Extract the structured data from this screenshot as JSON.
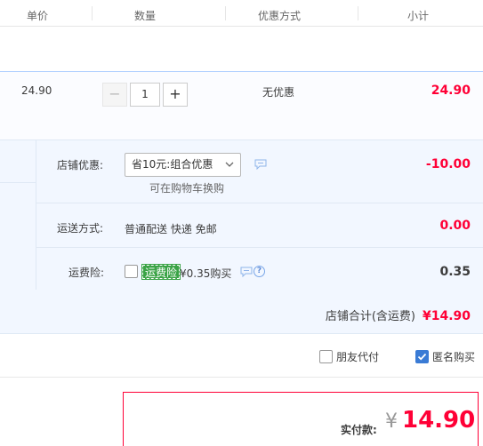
{
  "header": {
    "col_unit_price": "单价",
    "col_quantity": "数量",
    "col_promotion": "优惠方式",
    "col_subtotal": "小计"
  },
  "item": {
    "unit_price": "24.90",
    "quantity": "1",
    "minus_label": "−",
    "plus_label": "+",
    "promotion": "无优惠",
    "subtotal": "24.90"
  },
  "shop": {
    "discount_label": "店铺优惠:",
    "discount_selected": "省10元:组合优惠",
    "discount_hint": "可在购物车换购",
    "discount_amount": "-10.00",
    "shipping_label": "运送方式:",
    "shipping_method": "普通配送 快递 免邮",
    "shipping_amount": "0.00",
    "insurance_label": "运费险:",
    "insurance_tag": "运费险",
    "insurance_price": "¥0.35购买",
    "insurance_amount": "0.35",
    "total_label": "店铺合计(含运费)",
    "total_value": "¥14.90"
  },
  "options": {
    "friend_pay": "朋友代付",
    "anonymous": "匿名购买",
    "anonymous_checked": true
  },
  "payment": {
    "label": "实付款:",
    "currency": "¥",
    "amount": "14.90"
  },
  "colors": {
    "accent_red": "#ff0036",
    "tag_green": "#3aa346",
    "check_blue": "#3a7bd5"
  },
  "icons": [
    "chevron-down-icon",
    "chat-icon",
    "help-icon",
    "checkmark-icon"
  ]
}
